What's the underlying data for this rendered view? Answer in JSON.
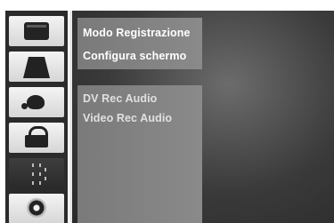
{
  "sidebar": {
    "items": [
      {
        "icon": "recorder-icon"
      },
      {
        "icon": "title-icon"
      },
      {
        "icon": "audio-icon"
      },
      {
        "icon": "lock-icon"
      },
      {
        "icon": "dots-icon",
        "active": true
      },
      {
        "icon": "disc-icon"
      }
    ]
  },
  "menu": {
    "top_items": [
      {
        "label": "Modo Registrazione"
      },
      {
        "label": "Configura schermo"
      }
    ],
    "lower_items": [
      {
        "label": "DV Rec Audio"
      },
      {
        "label": "Video Rec Audio"
      }
    ]
  },
  "colors": {
    "strip": "#2b2b2b",
    "panel_center": "#6c6c6c",
    "menu_block": "#858585",
    "text": "#ffffff"
  }
}
